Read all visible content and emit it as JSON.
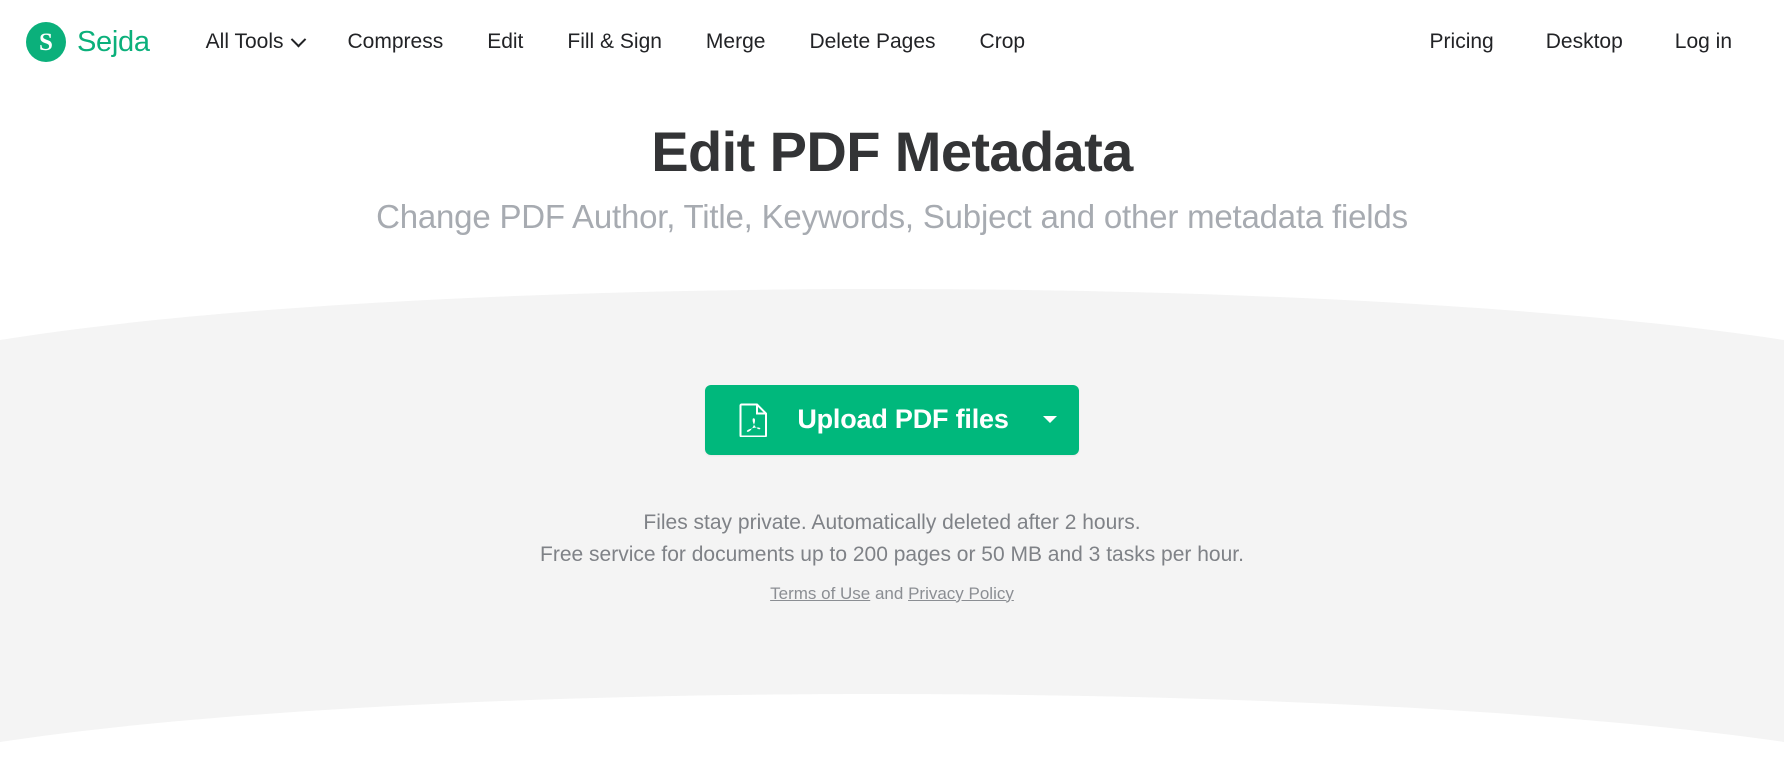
{
  "brand": {
    "mark_letter": "S",
    "name": "Sejda",
    "color": "#0bb07b"
  },
  "nav": {
    "main_items": [
      {
        "label": "All Tools",
        "has_caret": true
      },
      {
        "label": "Compress",
        "has_caret": false
      },
      {
        "label": "Edit",
        "has_caret": false
      },
      {
        "label": "Fill & Sign",
        "has_caret": false
      },
      {
        "label": "Merge",
        "has_caret": false
      },
      {
        "label": "Delete Pages",
        "has_caret": false
      },
      {
        "label": "Crop",
        "has_caret": false
      }
    ],
    "right_items": [
      {
        "label": "Pricing"
      },
      {
        "label": "Desktop"
      },
      {
        "label": "Log in"
      }
    ]
  },
  "hero": {
    "title": "Edit PDF Metadata",
    "subtitle": "Change PDF Author, Title, Keywords, Subject and other metadata fields",
    "title_color": "#333436",
    "subtitle_color": "#a7abb1"
  },
  "upload": {
    "button_label": "Upload PDF files",
    "button_color": "#00b87c",
    "icon": "pdf-file-icon",
    "dropdown_icon": "chevron-down-icon"
  },
  "notes": {
    "line1": "Files stay private. Automatically deleted after 2 hours.",
    "line2": "Free service for documents up to 200 pages or 50 MB and 3 tasks per hour.",
    "legal_prefix": "",
    "terms_label": "Terms of Use",
    "legal_conjunction": " and ",
    "privacy_label": "Privacy Policy"
  },
  "theme": {
    "page_background": "#ffffff",
    "panel_background": "#f4f4f4"
  }
}
